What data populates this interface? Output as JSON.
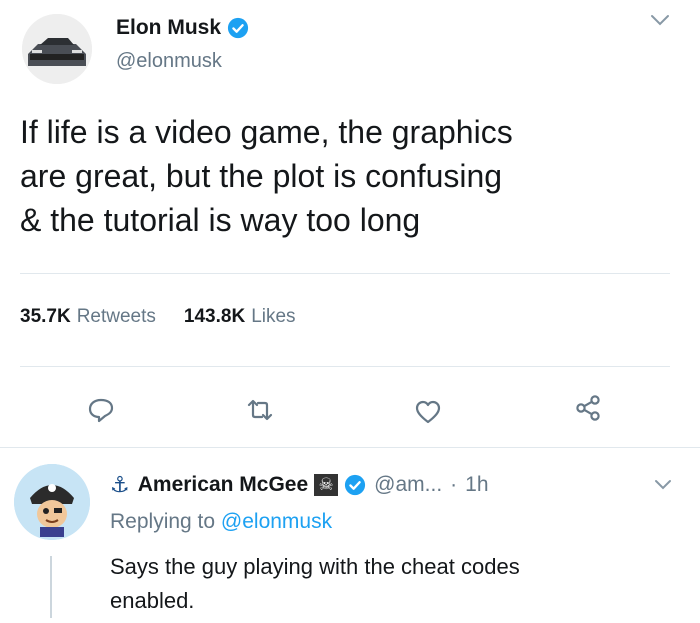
{
  "tweet": {
    "author_name": "Elon Musk",
    "author_handle": "@elonmusk",
    "text": "If life is a video game, the graphics\nare great, but the plot is confusing\n& the tutorial is way too long",
    "retweets_count": "35.7K",
    "retweets_label": "Retweets",
    "likes_count": "143.8K",
    "likes_label": "Likes"
  },
  "reply": {
    "anchor_glyph": "⚓",
    "author_name": "American McGee",
    "badge_glyph": "☠",
    "author_handle": "@am...",
    "separator": "·",
    "time": "1h",
    "replying_prefix": "Replying to",
    "replying_to": "@elonmusk",
    "text_line1": "Says the guy playing with the cheat codes",
    "text_line2": "enabled."
  },
  "colors": {
    "accent": "#1da1f2",
    "muted": "#657786",
    "text": "#14171a",
    "divider": "#e1e8ed"
  },
  "icons": [
    "chevron-down-icon",
    "verified-icon",
    "reply-icon",
    "retweet-icon",
    "like-icon",
    "share-icon",
    "anchor-icon",
    "skull-badge-icon"
  ]
}
